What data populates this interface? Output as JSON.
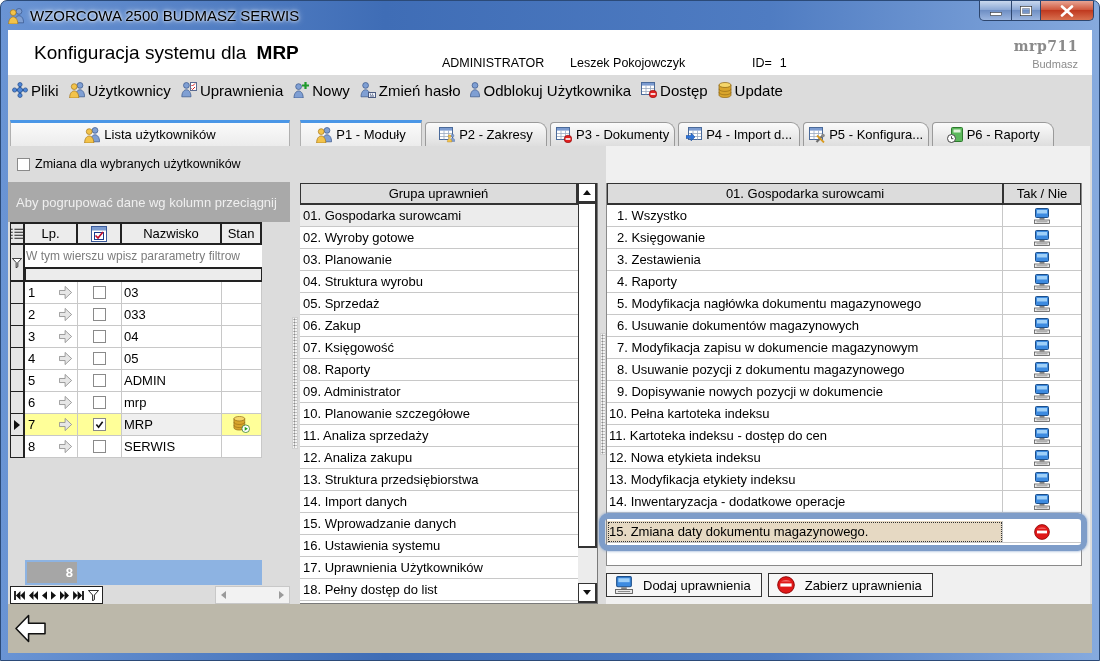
{
  "window": {
    "title": "WZORCOWA 2500 BUDMASZ SERWIS"
  },
  "header": {
    "title": "Konfiguracja systemu dla **MRP**",
    "role": "ADMINISTRATOR",
    "user": "Leszek Pokojowczyk",
    "id_label": "ID=",
    "id_value": "1",
    "logo": "mrp711",
    "logo_subtitle": "Budmasz"
  },
  "toolbar": [
    {
      "label": "Pliki"
    },
    {
      "label": "Użytkownicy"
    },
    {
      "label": "Uprawnienia"
    },
    {
      "label": "Nowy"
    },
    {
      "label": "Zmień hasło"
    },
    {
      "label": "Odblokuj Użytkownika"
    },
    {
      "label": "Dostęp"
    },
    {
      "label": "Update"
    }
  ],
  "left_tabs": [
    {
      "label": "Lista użytkowników",
      "selected": true
    }
  ],
  "tabs": [
    {
      "label": "P1 - Moduły",
      "selected": true
    },
    {
      "label": "P2 - Zakresy",
      "selected": false
    },
    {
      "label": "P3 - Dokumenty",
      "selected": false
    },
    {
      "label": "P4 - Import d...",
      "selected": false
    },
    {
      "label": "P5 - Konfigura...",
      "selected": false
    },
    {
      "label": "P6 - Raporty",
      "selected": false
    }
  ],
  "users_panel": {
    "change_checkbox": {
      "label": "Zmiana dla wybranych użytkowników",
      "checked": false
    },
    "group_hint": "Aby pogrupować dane wg kolumn przeciągnij",
    "columns": [
      {
        "kind": "text",
        "label": "Lp."
      },
      {
        "kind": "icon"
      },
      {
        "kind": "text",
        "label": "Nazwisko"
      },
      {
        "kind": "text",
        "label": "Stan"
      }
    ],
    "filter_hint": "W tym wierszu wpisz pararametry filtrow",
    "rows": [
      {
        "lp": "1",
        "checked": false,
        "name": "03",
        "status_icon": false,
        "selected": false
      },
      {
        "lp": "2",
        "checked": false,
        "name": "033",
        "status_icon": false,
        "selected": false
      },
      {
        "lp": "3",
        "checked": false,
        "name": "04",
        "status_icon": false,
        "selected": false
      },
      {
        "lp": "4",
        "checked": false,
        "name": "05",
        "status_icon": false,
        "selected": false
      },
      {
        "lp": "5",
        "checked": false,
        "name": "ADMIN",
        "status_icon": false,
        "selected": false
      },
      {
        "lp": "6",
        "checked": false,
        "name": "mrp",
        "status_icon": false,
        "selected": false
      },
      {
        "lp": "7",
        "checked": true,
        "name": "MRP",
        "status_icon": true,
        "selected": true
      },
      {
        "lp": "8",
        "checked": false,
        "name": "SERWIS",
        "status_icon": false,
        "selected": false
      }
    ],
    "count": "8"
  },
  "groups_panel": {
    "header": "Grupa uprawnień",
    "rows": [
      {
        "label": "01. Gospodarka surowcami",
        "selected": true
      },
      {
        "label": "02. Wyroby gotowe",
        "selected": false
      },
      {
        "label": "03. Planowanie",
        "selected": false
      },
      {
        "label": "04. Struktura wyrobu",
        "selected": false
      },
      {
        "label": "05. Sprzedaż",
        "selected": false
      },
      {
        "label": "06. Zakup",
        "selected": false
      },
      {
        "label": "07. Księgowość",
        "selected": false
      },
      {
        "label": "08. Raporty",
        "selected": false
      },
      {
        "label": "09. Administrator",
        "selected": false
      },
      {
        "label": "10. Planowanie szczegółowe",
        "selected": false
      },
      {
        "label": "11. Analiza sprzedaży",
        "selected": false
      },
      {
        "label": "12. Analiza zakupu",
        "selected": false
      },
      {
        "label": "13. Struktura przedsiębiorstwa",
        "selected": false
      },
      {
        "label": "14. Import danych",
        "selected": false
      },
      {
        "label": "15. Wprowadzanie danych",
        "selected": false
      },
      {
        "label": "16. Ustawienia systemu",
        "selected": false
      },
      {
        "label": "17. Uprawnienia Użytkowników",
        "selected": false
      },
      {
        "label": "18. Pełny dostęp do list",
        "selected": false
      }
    ]
  },
  "permissions_panel": {
    "header": "01. Gospodarka surowcami",
    "column": "Tak / Nie",
    "rows": [
      {
        "label": "1. Wszystko",
        "granted": true,
        "selected": false
      },
      {
        "label": "2. Księgowanie",
        "granted": true,
        "selected": false
      },
      {
        "label": "3. Zestawienia",
        "granted": true,
        "selected": false
      },
      {
        "label": "4. Raporty",
        "granted": true,
        "selected": false
      },
      {
        "label": "5. Modyfikacja nagłówka dokumentu magazynowego",
        "granted": true,
        "selected": false
      },
      {
        "label": "6. Usuwanie dokumentów magazynowych",
        "granted": true,
        "selected": false
      },
      {
        "label": "7. Modyfikacja zapisu w dokumencie magazynowym",
        "granted": true,
        "selected": false
      },
      {
        "label": "8. Usuwanie pozycji z dokumentu magazynowego",
        "granted": true,
        "selected": false
      },
      {
        "label": "9. Dopisywanie nowych pozycji w dokumencie",
        "granted": true,
        "selected": false
      },
      {
        "label": "10. Pełna kartoteka indeksu",
        "granted": true,
        "selected": false
      },
      {
        "label": "11. Kartoteka indeksu - dostęp do cen",
        "granted": true,
        "selected": false
      },
      {
        "label": "12. Nowa etykieta indeksu",
        "granted": true,
        "selected": false
      },
      {
        "label": "13. Modyfikacja etykiety indeksu",
        "granted": true,
        "selected": false
      },
      {
        "label": "14. Inwentaryzacja - dodatkowe operacje",
        "granted": true,
        "selected": false
      },
      {
        "label": "15. Zmiana daty dokumentu magazynowego.",
        "granted": false,
        "selected": true
      }
    ],
    "buttons": [
      {
        "label": "Dodaj uprawnienia"
      },
      {
        "label": "Zabierz uprawnienia"
      }
    ]
  }
}
